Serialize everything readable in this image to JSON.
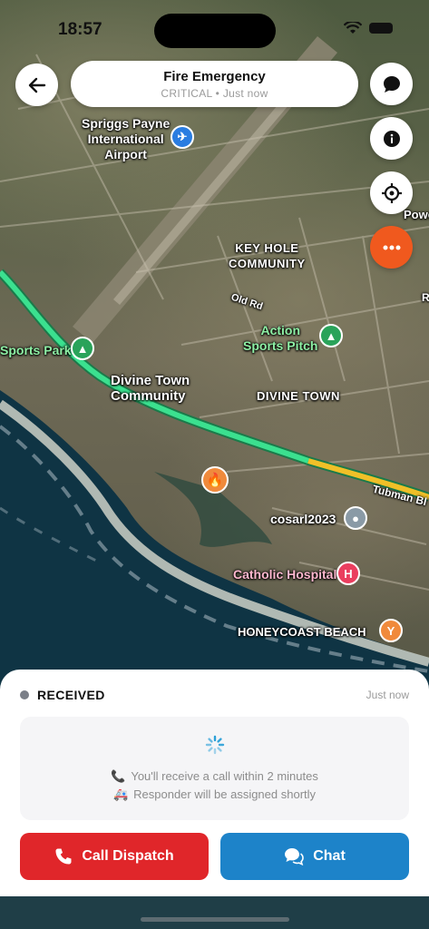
{
  "status_bar": {
    "time": "18:57"
  },
  "header": {
    "title": "Fire Emergency",
    "subtitle": "CRITICAL • Just now"
  },
  "map": {
    "labels": {
      "airport": "Spriggs Payne\nInternational\nAirport",
      "key_hole": "KEY HOLE\nCOMMUNITY",
      "old_rd": "Old Rd",
      "action_sports": "Action\nSports Pitch",
      "sports_park": "Sports Park",
      "divine_town_community": "Divine Town\nCommunity",
      "divine_town": "DIVINE TOWN",
      "tubman": "Tubman Bl",
      "cosarl": "cosarl2023",
      "catholic_hospital": "Catholic Hospital",
      "honeycoast": "HONEYCOAST BEACH",
      "powe": "Powe",
      "edge_r": "R"
    },
    "icons": {
      "airport_pin": "airplane-icon",
      "fire_pin": "fire-icon",
      "hospital_pin": "hospital-icon",
      "cocktail_pin": "cocktail-icon",
      "tree_pin": "tree-icon",
      "location_pin": "location-icon"
    },
    "colors": {
      "route": "#3be08f",
      "fire_pin": "#f08a3c",
      "hospital": "#ea3e5f"
    }
  },
  "fabs": {
    "chat_icon": "chat-bubble-icon",
    "info_icon": "info-icon",
    "locate_icon": "crosshair-icon",
    "more_icon": "more-icon"
  },
  "sheet": {
    "status": "RECEIVED",
    "status_time": "Just now",
    "info_line_1": "You'll receive a call within 2 minutes",
    "info_line_2": "Responder will be assigned shortly",
    "call_button": "Call Dispatch",
    "chat_button": "Chat"
  },
  "colors": {
    "accent_orange": "#f0591e",
    "call_red": "#e0262a",
    "chat_blue": "#1d83c9"
  }
}
